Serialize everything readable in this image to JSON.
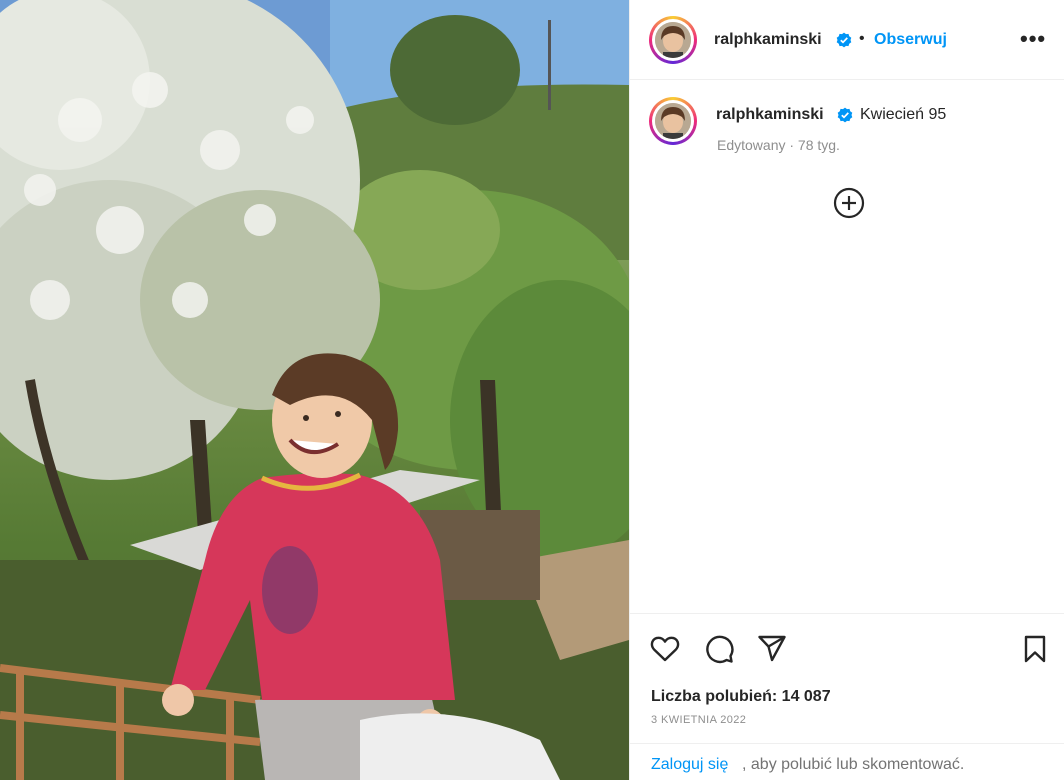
{
  "post": {
    "image_alt": "Zdjęcie chłopca w czerwonej bluzie na tle kwitnących drzew",
    "author": "ralphkaminski",
    "follow_label": "Obserwuj",
    "dot": "•",
    "more_label": "•••",
    "caption": "Kwiecień 95",
    "edited_meta": "Edytowany · 78 tyg.",
    "likes_text": "Liczba polubień: 14 087",
    "date": "3 KWIETNIA 2022",
    "login_link": "Zaloguj się",
    "login_rest": ", aby polubić lub skomentować."
  },
  "icons": {
    "verified": "verified-badge-icon",
    "more": "more-options-icon",
    "add": "plus-circle-icon",
    "like": "heart-icon",
    "comment": "comment-icon",
    "share": "paper-plane-icon",
    "save": "bookmark-icon"
  },
  "colors": {
    "link": "#0095f6",
    "verified": "#0095f6",
    "text": "#262626",
    "muted": "#8e8e8e"
  }
}
